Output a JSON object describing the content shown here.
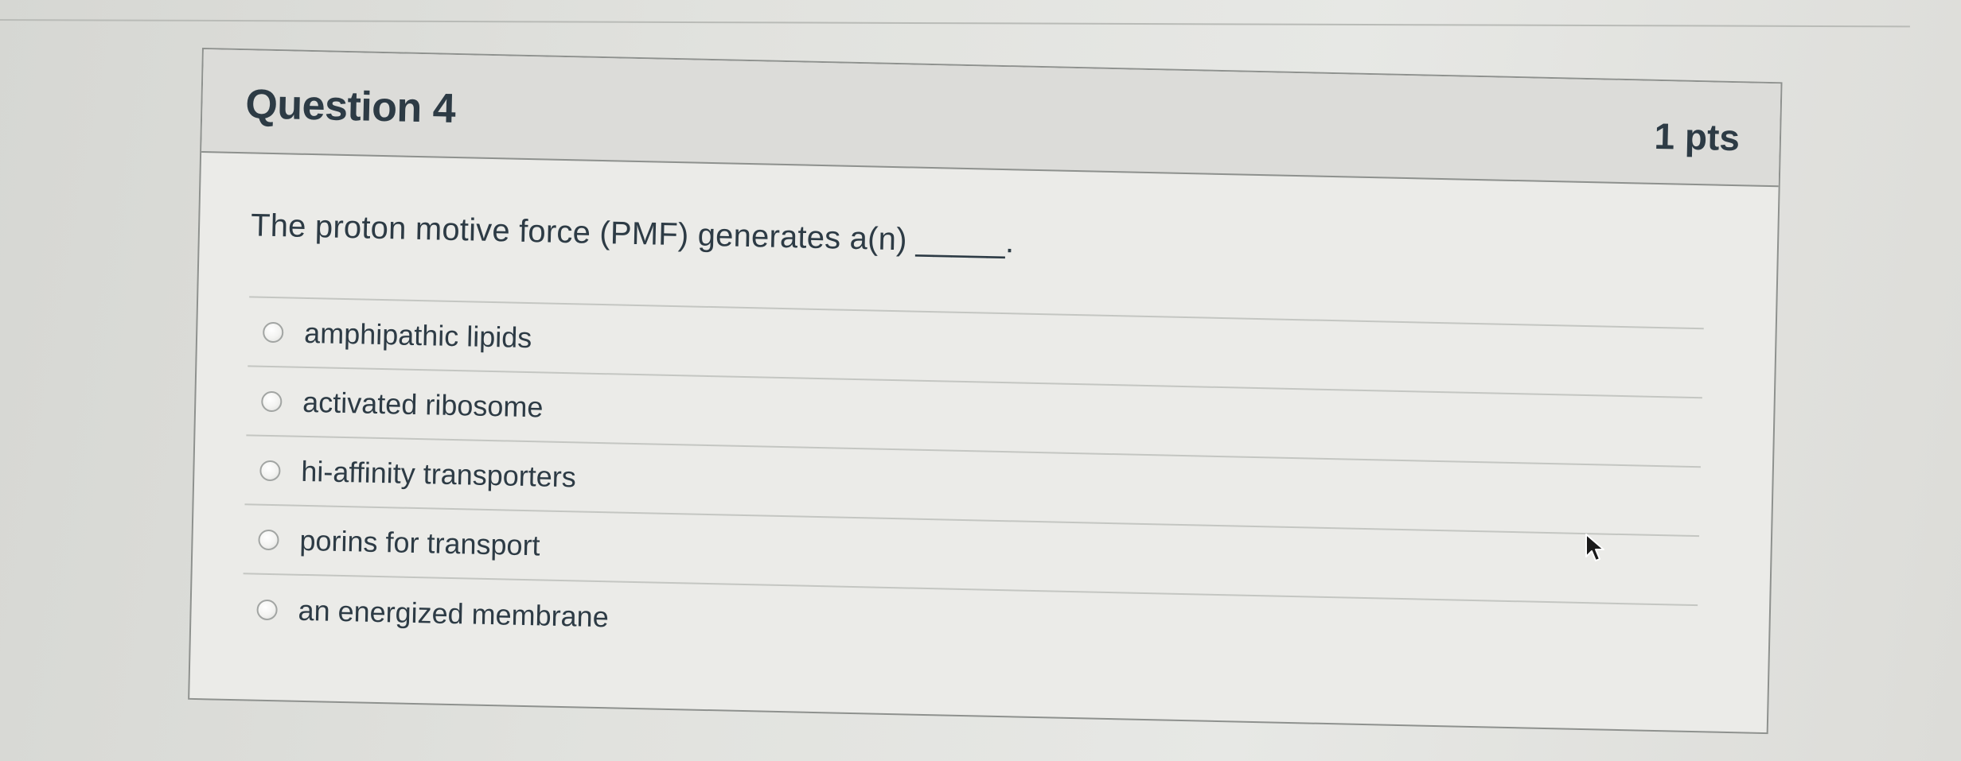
{
  "question": {
    "title": "Question 4",
    "points": "1 pts",
    "text": "The proton motive force (PMF) generates a(n) _____."
  },
  "answers": [
    {
      "label": "amphipathic lipids",
      "selected": false
    },
    {
      "label": "activated ribosome",
      "selected": false
    },
    {
      "label": "hi-affinity transporters",
      "selected": false
    },
    {
      "label": "porins for transport",
      "selected": false
    },
    {
      "label": "an energized membrane",
      "selected": false
    }
  ],
  "icons": {
    "radio": "radio-button-icon",
    "cursor": "mouse-pointer-icon"
  },
  "colors": {
    "text": "#2d3b45",
    "header_bg": "#dcdcd9",
    "card_bg": "#ebebe8",
    "border": "#8e918e"
  }
}
